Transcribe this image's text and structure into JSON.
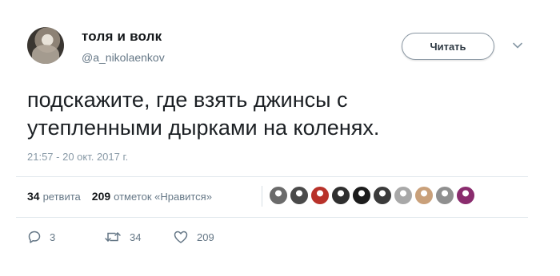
{
  "author": {
    "display_name": "толя и волк",
    "handle": "@a_nikolaenkov"
  },
  "follow_button": {
    "label": "Читать"
  },
  "tweet": {
    "text": "подскажите, где взять джинсы с\nутепленными дырками на коленях.",
    "timestamp": "21:57 - 20 окт. 2017 г."
  },
  "stats": {
    "retweets_count": "34",
    "retweets_label": "ретвита",
    "likes_count": "209",
    "likes_label": "отметок «Нравится»"
  },
  "likers": [
    {
      "color": "#6b6b6b",
      "icon": "user-avatar"
    },
    {
      "color": "#4a4a4a",
      "icon": "user-avatar"
    },
    {
      "color": "#b8322a",
      "icon": "user-avatar"
    },
    {
      "color": "#2f2f2f",
      "icon": "user-avatar"
    },
    {
      "color": "#1c1c1c",
      "icon": "user-avatar"
    },
    {
      "color": "#3b3b3b",
      "icon": "user-avatar"
    },
    {
      "color": "#a8a8a8",
      "icon": "user-avatar"
    },
    {
      "color": "#c9a07a",
      "icon": "user-avatar"
    },
    {
      "color": "#8f8f8f",
      "icon": "user-avatar"
    },
    {
      "color": "#8a2c6e",
      "icon": "user-avatar"
    }
  ],
  "actions": {
    "reply": {
      "count": "3",
      "icon": "reply-icon"
    },
    "retweet": {
      "count": "34",
      "icon": "retweet-icon"
    },
    "like": {
      "count": "209",
      "icon": "heart-icon"
    }
  }
}
